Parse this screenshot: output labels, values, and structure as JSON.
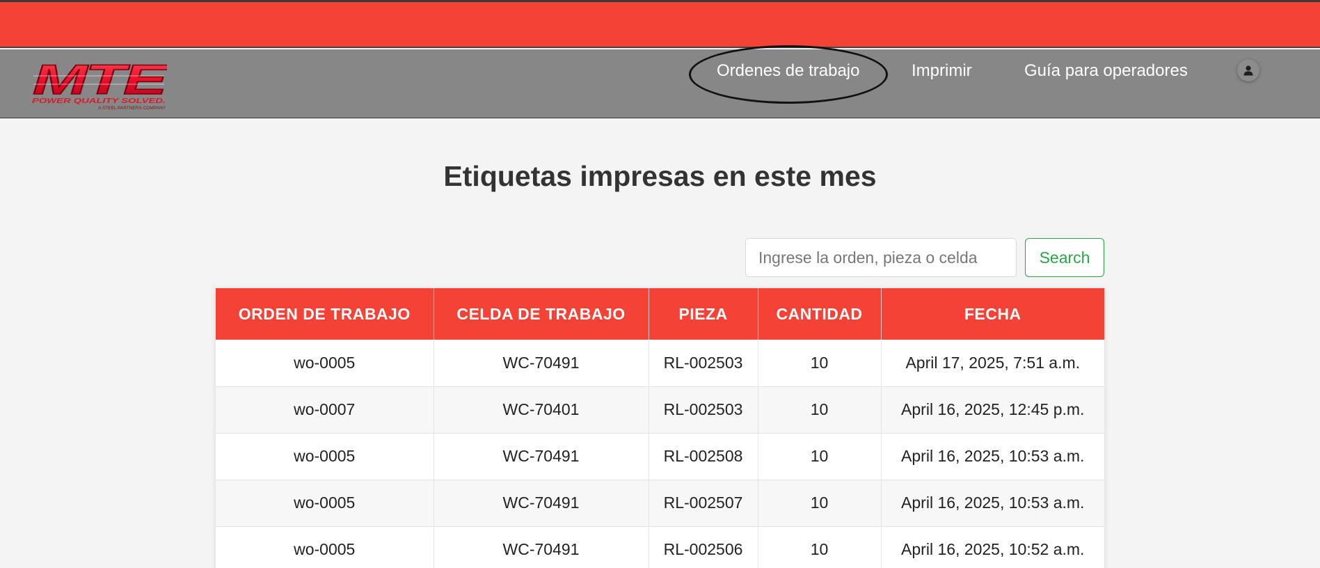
{
  "brand": {
    "logo_text": "MTE",
    "tagline": "POWER QUALITY SOLVED.",
    "subtagline": "A STEEL PARTNERS COMPANY",
    "accent_color": "#f44336"
  },
  "nav": {
    "items": [
      {
        "label": "Ordenes de trabajo"
      },
      {
        "label": "Imprimir"
      },
      {
        "label": "Guía para operadores"
      }
    ],
    "user_icon": "user-icon"
  },
  "page": {
    "title": "Etiquetas impresas en este mes"
  },
  "search": {
    "placeholder": "Ingrese la orden, pieza o celda",
    "value": "",
    "button_label": "Search"
  },
  "table": {
    "headers": [
      "ORDEN DE TRABAJO",
      "CELDA DE TRABAJO",
      "PIEZA",
      "CANTIDAD",
      "FECHA"
    ],
    "rows": [
      [
        "wo-0005",
        "WC-70491",
        "RL-002503",
        "10",
        "April 17, 2025, 7:51 a.m."
      ],
      [
        "wo-0007",
        "WC-70401",
        "RL-002503",
        "10",
        "April 16, 2025, 12:45 p.m."
      ],
      [
        "wo-0005",
        "WC-70491",
        "RL-002508",
        "10",
        "April 16, 2025, 10:53 a.m."
      ],
      [
        "wo-0005",
        "WC-70491",
        "RL-002507",
        "10",
        "April 16, 2025, 10:53 a.m."
      ],
      [
        "wo-0005",
        "WC-70491",
        "RL-002506",
        "10",
        "April 16, 2025, 10:52 a.m."
      ]
    ]
  }
}
